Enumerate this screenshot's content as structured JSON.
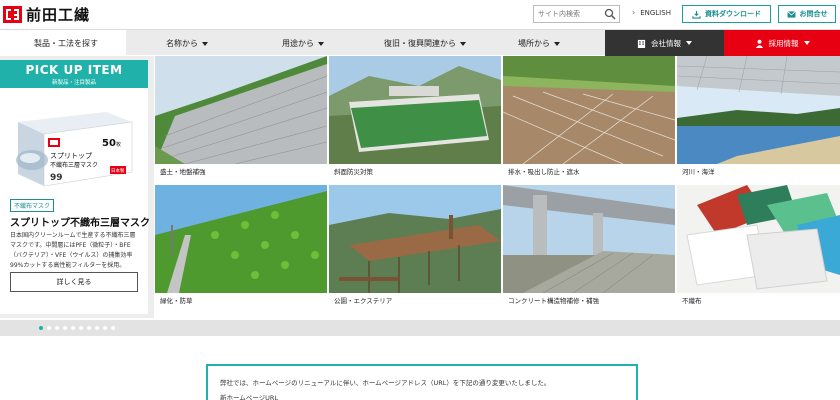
{
  "header": {
    "logo_text": "前田工繊",
    "search": {
      "placeholder": "サイト内検索"
    },
    "english_label": "ENGLISH",
    "download_label": "資料ダウンロード",
    "contact_label": "お問合せ"
  },
  "nav": {
    "products_label": "製品・工法を探す",
    "items": [
      {
        "label": "名称から"
      },
      {
        "label": "用途から"
      },
      {
        "label": "復旧・復興関連から"
      },
      {
        "label": "場所から"
      }
    ],
    "company_label": "会社情報",
    "recruit_label": "採用情報"
  },
  "pickup": {
    "title": "PICK UP ITEM",
    "subtitle": "新製品・注目製品",
    "product_box": {
      "brand_text": "スプリトップ",
      "name_text": "不織布三層マスク",
      "count_text": "50",
      "unit_text": "枚",
      "percent_text": "99",
      "made_text": "日本製"
    },
    "tag": "不織布マスク",
    "product_title": "スプリトップ不織布三層マスク",
    "description": "日本国内クリーンルームで生産する不織布三層マスクです。中間層にはPFE（微粒子）・BFE（バクテリア）・VFE（ウイルス）の捕集効率99%カットする高性能フィルターを採用。",
    "button_label": "詳しく見る",
    "dots_count": 10,
    "active_dot": 0
  },
  "categories": [
    {
      "label": "盛土・地盤補強"
    },
    {
      "label": "斜面防災対策"
    },
    {
      "label": "排水・吸出し防止・遮水"
    },
    {
      "label": "河川・海洋"
    },
    {
      "label": "緑化・防草"
    },
    {
      "label": "公園・エクステリア"
    },
    {
      "label": "コンクリート構造物補修・補強"
    },
    {
      "label": "不織布"
    }
  ],
  "notice": {
    "line1": "弊社では、ホームページのリニューアルに伴い、ホームページアドレス（URL）を下記の通り変更いたしました。",
    "line2": "新ホームページURL"
  },
  "colors": {
    "teal": "#20b2aa",
    "red": "#e60012",
    "dark": "#333333"
  }
}
